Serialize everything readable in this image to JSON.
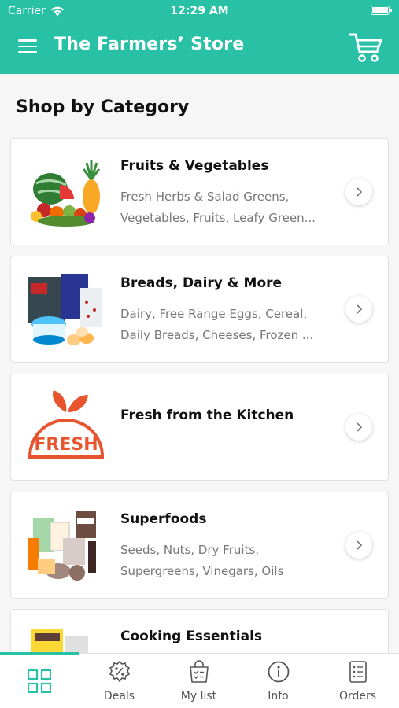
{
  "status": {
    "carrier": "Carrier",
    "time": "12:29 AM"
  },
  "header": {
    "title": "The Farmers’ Store",
    "menu_icon": "hamburger-menu-icon",
    "cart_icon": "shopping-cart-icon"
  },
  "section": {
    "title": "Shop by Category"
  },
  "categories": [
    {
      "name": "Fruits & Vegetables",
      "desc_line1": "Fresh Herbs & Salad Greens,",
      "desc_line2": "Vegetables, Fruits, Leafy Green...",
      "icon": "fruits-vegetables-image"
    },
    {
      "name": "Breads, Dairy & More",
      "desc_line1": "Dairy, Free Range Eggs, Cereal,",
      "desc_line2": "Daily Breads, Cheeses, Frozen ...",
      "icon": "breads-dairy-image"
    },
    {
      "name": "Fresh from the Kitchen",
      "logo_text": "FRESH",
      "icon": "fresh-kitchen-logo"
    },
    {
      "name": "Superfoods",
      "desc_line1": "Seeds, Nuts, Dry Fruits,",
      "desc_line2": "Supergreens, Vinegars, Oils",
      "icon": "superfoods-image"
    },
    {
      "name": "Cooking Essentials",
      "icon": "cooking-essentials-image"
    }
  ],
  "tabs": [
    {
      "label": "",
      "icon": "grid-icon",
      "active": true
    },
    {
      "label": "Deals",
      "icon": "discount-badge-icon"
    },
    {
      "label": "My list",
      "icon": "shopping-list-bag-icon"
    },
    {
      "label": "Info",
      "icon": "info-icon"
    },
    {
      "label": "Orders",
      "icon": "orders-list-icon"
    }
  ],
  "colors": {
    "brand": "#28c1a6",
    "fresh_logo": "#e8542e"
  }
}
